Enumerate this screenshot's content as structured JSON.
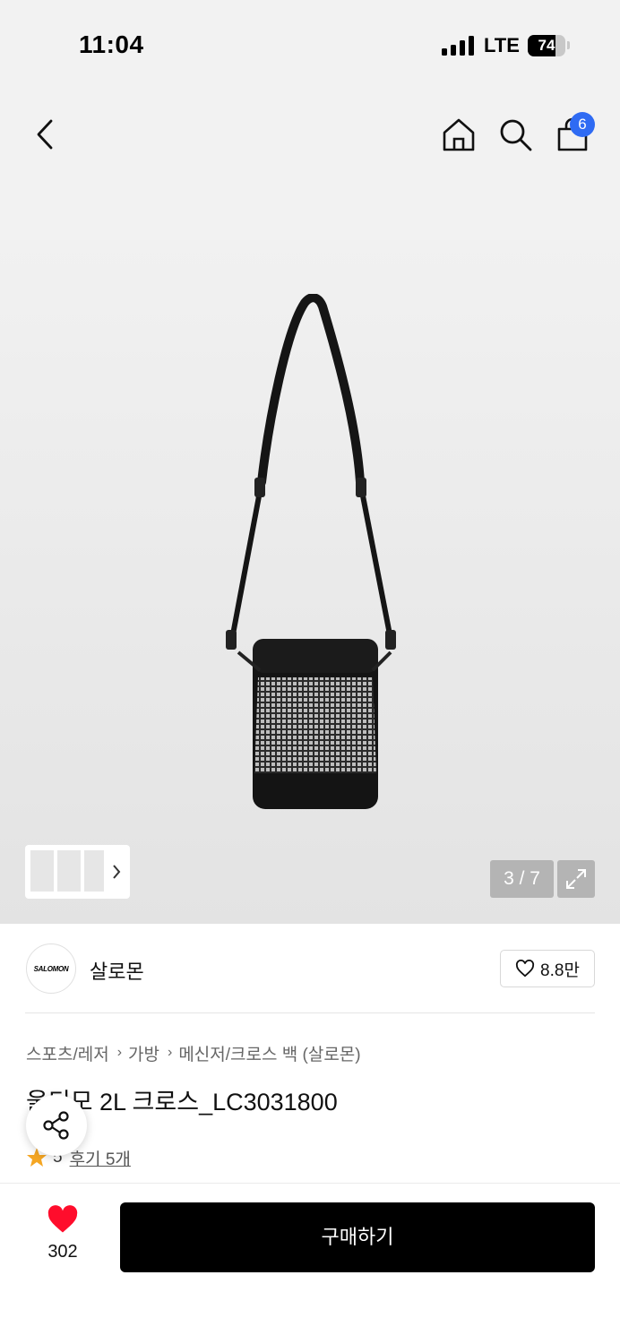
{
  "status_bar": {
    "time": "11:04",
    "network": "LTE",
    "battery_text": "74",
    "battery_level": 0.74
  },
  "nav": {
    "back_icon": "chevron-left-icon",
    "home_icon": "home-icon",
    "search_icon": "search-icon",
    "cart_icon": "shopping-bag-icon",
    "cart_badge": "6",
    "badge_color": "#2f6bf3"
  },
  "gallery": {
    "counter": "3 / 7",
    "expand_icon": "expand-icon",
    "thumbs_more_icon": "chevron-right-icon"
  },
  "brand": {
    "logo_text": "SALOMON",
    "name": "살로몬",
    "like_count": "8.8만"
  },
  "product": {
    "breadcrumb": [
      "스포츠/레저",
      "가방",
      "메신저/크로스 백 (살로몬)"
    ],
    "breadcrumb_sep": "›",
    "title": "울티모 2L 크로스_LC3031800",
    "rating": "5",
    "reviews_label": "후기 5개",
    "star_color": "#f5a623"
  },
  "bottom": {
    "wish_count": "302",
    "wish_color": "#ff0d2c",
    "buy_label": "구매하기"
  }
}
